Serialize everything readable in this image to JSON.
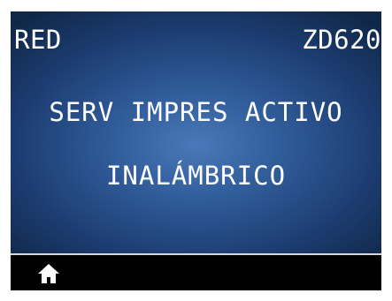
{
  "header": {
    "menu_title": "RED",
    "model": "ZD620"
  },
  "message": {
    "line1": "SERV IMPRES ACTIVO",
    "line2": "INALÁMBRICO"
  },
  "footer": {
    "home_icon": "home-icon"
  },
  "colors": {
    "screen_center": "#4a78b8",
    "screen_edge": "#102848",
    "footer_bg": "#000000",
    "text": "#ffffff"
  }
}
